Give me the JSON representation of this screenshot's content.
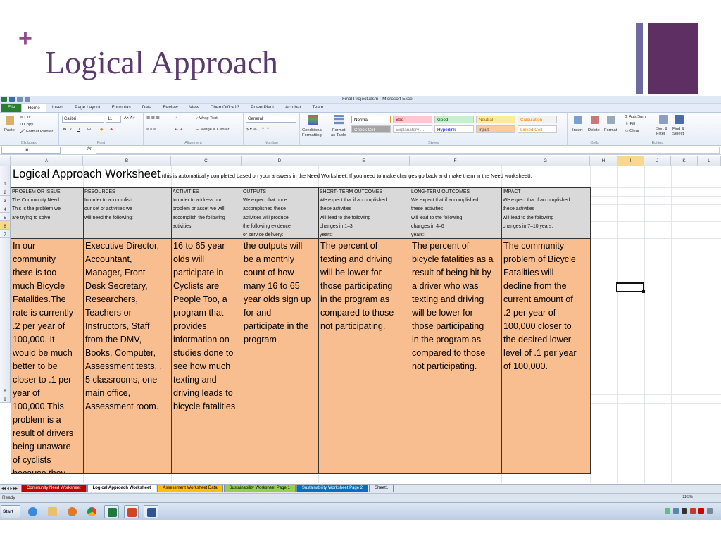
{
  "slide": {
    "plus": "+",
    "title": "Logical Approach",
    "colors": {
      "title": "#5b3b6e",
      "accent": "#8e4a8c",
      "bar1": "#6f6a9e",
      "bar2": "#5e2f63"
    }
  },
  "excel": {
    "window_title": "Final Project.xlsm - Microsoft Excel",
    "tabs": [
      "File",
      "Home",
      "Insert",
      "Page Layout",
      "Formulas",
      "Data",
      "Review",
      "View",
      "ChemOffice13",
      "PowerPivot",
      "Acrobat",
      "Team"
    ],
    "active_tab": "Home",
    "ribbon": {
      "clipboard": {
        "paste": "Paste",
        "cut": "Cut",
        "copy": "Copy",
        "format_painter": "Format Painter",
        "label": "Clipboard"
      },
      "font": {
        "name": "Calibri",
        "size": "11",
        "label": "Font"
      },
      "alignment": {
        "wrap": "Wrap Text",
        "merge": "Merge & Center",
        "label": "Alignment"
      },
      "number": {
        "format": "General",
        "label": "Number"
      },
      "styles": {
        "conditional": "Conditional",
        "conditional2": "Formatting",
        "format_table": "Format",
        "format_table2": "as Table",
        "label": "Styles",
        "cells": [
          {
            "name": "Normal",
            "bg": "#ffffff",
            "fg": "#000000"
          },
          {
            "name": "Bad",
            "bg": "#ffc7ce",
            "fg": "#9c0006"
          },
          {
            "name": "Good",
            "bg": "#c6efce",
            "fg": "#006100"
          },
          {
            "name": "Neutral",
            "bg": "#ffeb9c",
            "fg": "#9c6500"
          },
          {
            "name": "Calculation",
            "bg": "#f2f2f2",
            "fg": "#fa7d00"
          },
          {
            "name": "Check Cell",
            "bg": "#a5a5a5",
            "fg": "#ffffff"
          },
          {
            "name": "Explanatory ...",
            "bg": "#ffffff",
            "fg": "#7f7f7f"
          },
          {
            "name": "Hyperlink",
            "bg": "#ffffff",
            "fg": "#0000ff"
          },
          {
            "name": "Input",
            "bg": "#ffcc99",
            "fg": "#3f3f76"
          },
          {
            "name": "Linked Cell",
            "bg": "#ffffff",
            "fg": "#fa7d00"
          }
        ]
      },
      "cells": {
        "insert": "Insert",
        "delete": "Delete",
        "format": "Format",
        "label": "Cells"
      },
      "editing": {
        "autosum": "AutoSum",
        "fill": "Fill",
        "clear": "Clear",
        "sort": "Sort &",
        "sort2": "Filter",
        "find": "Find &",
        "find2": "Select",
        "label": "Editing"
      }
    },
    "name_box": "I6",
    "fx": "fx",
    "columns": [
      "A",
      "B",
      "C",
      "D",
      "E",
      "F",
      "G",
      "H",
      "I",
      "J",
      "K",
      "L"
    ],
    "selected_column": "I",
    "rows": [
      "1",
      "2",
      "3",
      "4",
      "5",
      "6",
      "7",
      "8",
      "9"
    ],
    "selected_row": "6",
    "worksheet_title": "Logical Approach Worksheet",
    "worksheet_subtitle": "(this is automatically completed based on your answers in the Need Worksheet. If you need to make changes go back and make them in the Need worksheet).",
    "headers": [
      [
        "PROBLEM OR ISSUE",
        "The Community Need",
        "This is the problem we",
        "are trying to solve"
      ],
      [
        "RESOURCES",
        "In order to accomplish",
        "our set of activities we",
        "will need the following:"
      ],
      [
        "ACTIVITIES",
        "In order to address our",
        "problem or asset we will",
        "accomplish the following",
        "activities:"
      ],
      [
        "OUTPUTS",
        "We expect that once",
        "accomplished these",
        "activities will produce",
        "the following evidence",
        "or service delivery:"
      ],
      [
        "SHORT- TERM OUTCOMES",
        "We expect that if accomplished",
        "these activities",
        "will lead to the following",
        "changes in 1–3",
        "years:"
      ],
      [
        "LONG-TERM OUTCOMES",
        "We expect that if accomplished",
        "these activities",
        "will lead to the following",
        "changes in 4–6",
        "years:"
      ],
      [
        "IMPACT",
        "We expect that if accomplished",
        "these activities",
        "will lead to the following",
        "changes in 7–10 years:"
      ]
    ],
    "cells": [
      [
        "In our",
        "community",
        "there is too",
        "much Bicycle",
        "Fatalities.The",
        "rate is currently",
        ".2 per year of",
        "100,000. It",
        "would be much",
        "better to be",
        "closer to .1 per",
        "year of",
        "100,000.This",
        "problem is a",
        "result of drivers",
        "being unaware",
        "of cyclists",
        "because they"
      ],
      [
        "Executive Director,",
        "Accountant,",
        "Manager, Front",
        "Desk Secretary,",
        "Researchers,",
        "Teachers or",
        "Instructors, Staff",
        "from the DMV,",
        "Books, Computer,",
        "Assessment tests, ,",
        "5 classrooms, one",
        "main office,",
        "Assessment room."
      ],
      [
        "16 to 65 year",
        "olds will",
        "participate in",
        "Cyclists are",
        "People Too, a",
        "program that",
        "provides",
        "information on",
        "studies done to",
        "see how much",
        "texting and",
        "driving leads to",
        "bicycle fatalities"
      ],
      [
        "the outputs will",
        "be a monthly",
        "count of how",
        "many 16 to 65",
        "year olds sign up",
        "for and",
        "participate in the",
        "program"
      ],
      [
        "The percent of",
        "texting and driving",
        "will be lower for",
        "those participating",
        "in the program as",
        "compared to those",
        "not participating."
      ],
      [
        "The percent of",
        "bicycle fatalities as a",
        "result of being hit by",
        "a driver who was",
        "texting and driving",
        "will be lower for",
        "those participating",
        "in the program as",
        "compared to those",
        "not participating."
      ],
      [
        "The community",
        "problem of Bicycle",
        "Fatalities will",
        "decline from the",
        "current amount of",
        ".2 per year of",
        "100,000 closer to",
        "the desired lower",
        "level of .1 per year",
        "of 100,000."
      ]
    ],
    "sheet_tabs": [
      {
        "label": "Community Need Worksheet",
        "bg": "#c00000",
        "fg": "#ffffff"
      },
      {
        "label": "Logical Approach Worksheet",
        "bg": "#ffffff",
        "fg": "#000000"
      },
      {
        "label": "Assessment Worksheet Data",
        "bg": "#ffc000",
        "fg": "#000000"
      },
      {
        "label": "Sustainability Worksheet Page 1",
        "bg": "#92d050",
        "fg": "#000000"
      },
      {
        "label": "Sustainability Worksheet Page 2",
        "bg": "#0070c0",
        "fg": "#ffffff"
      },
      {
        "label": "Sheet1",
        "bg": "#dfe6ef",
        "fg": "#000000"
      }
    ],
    "active_sheet": "Logical Approach Worksheet",
    "status": "Ready",
    "zoom": "110%",
    "taskbar": {
      "start": "Start"
    }
  }
}
